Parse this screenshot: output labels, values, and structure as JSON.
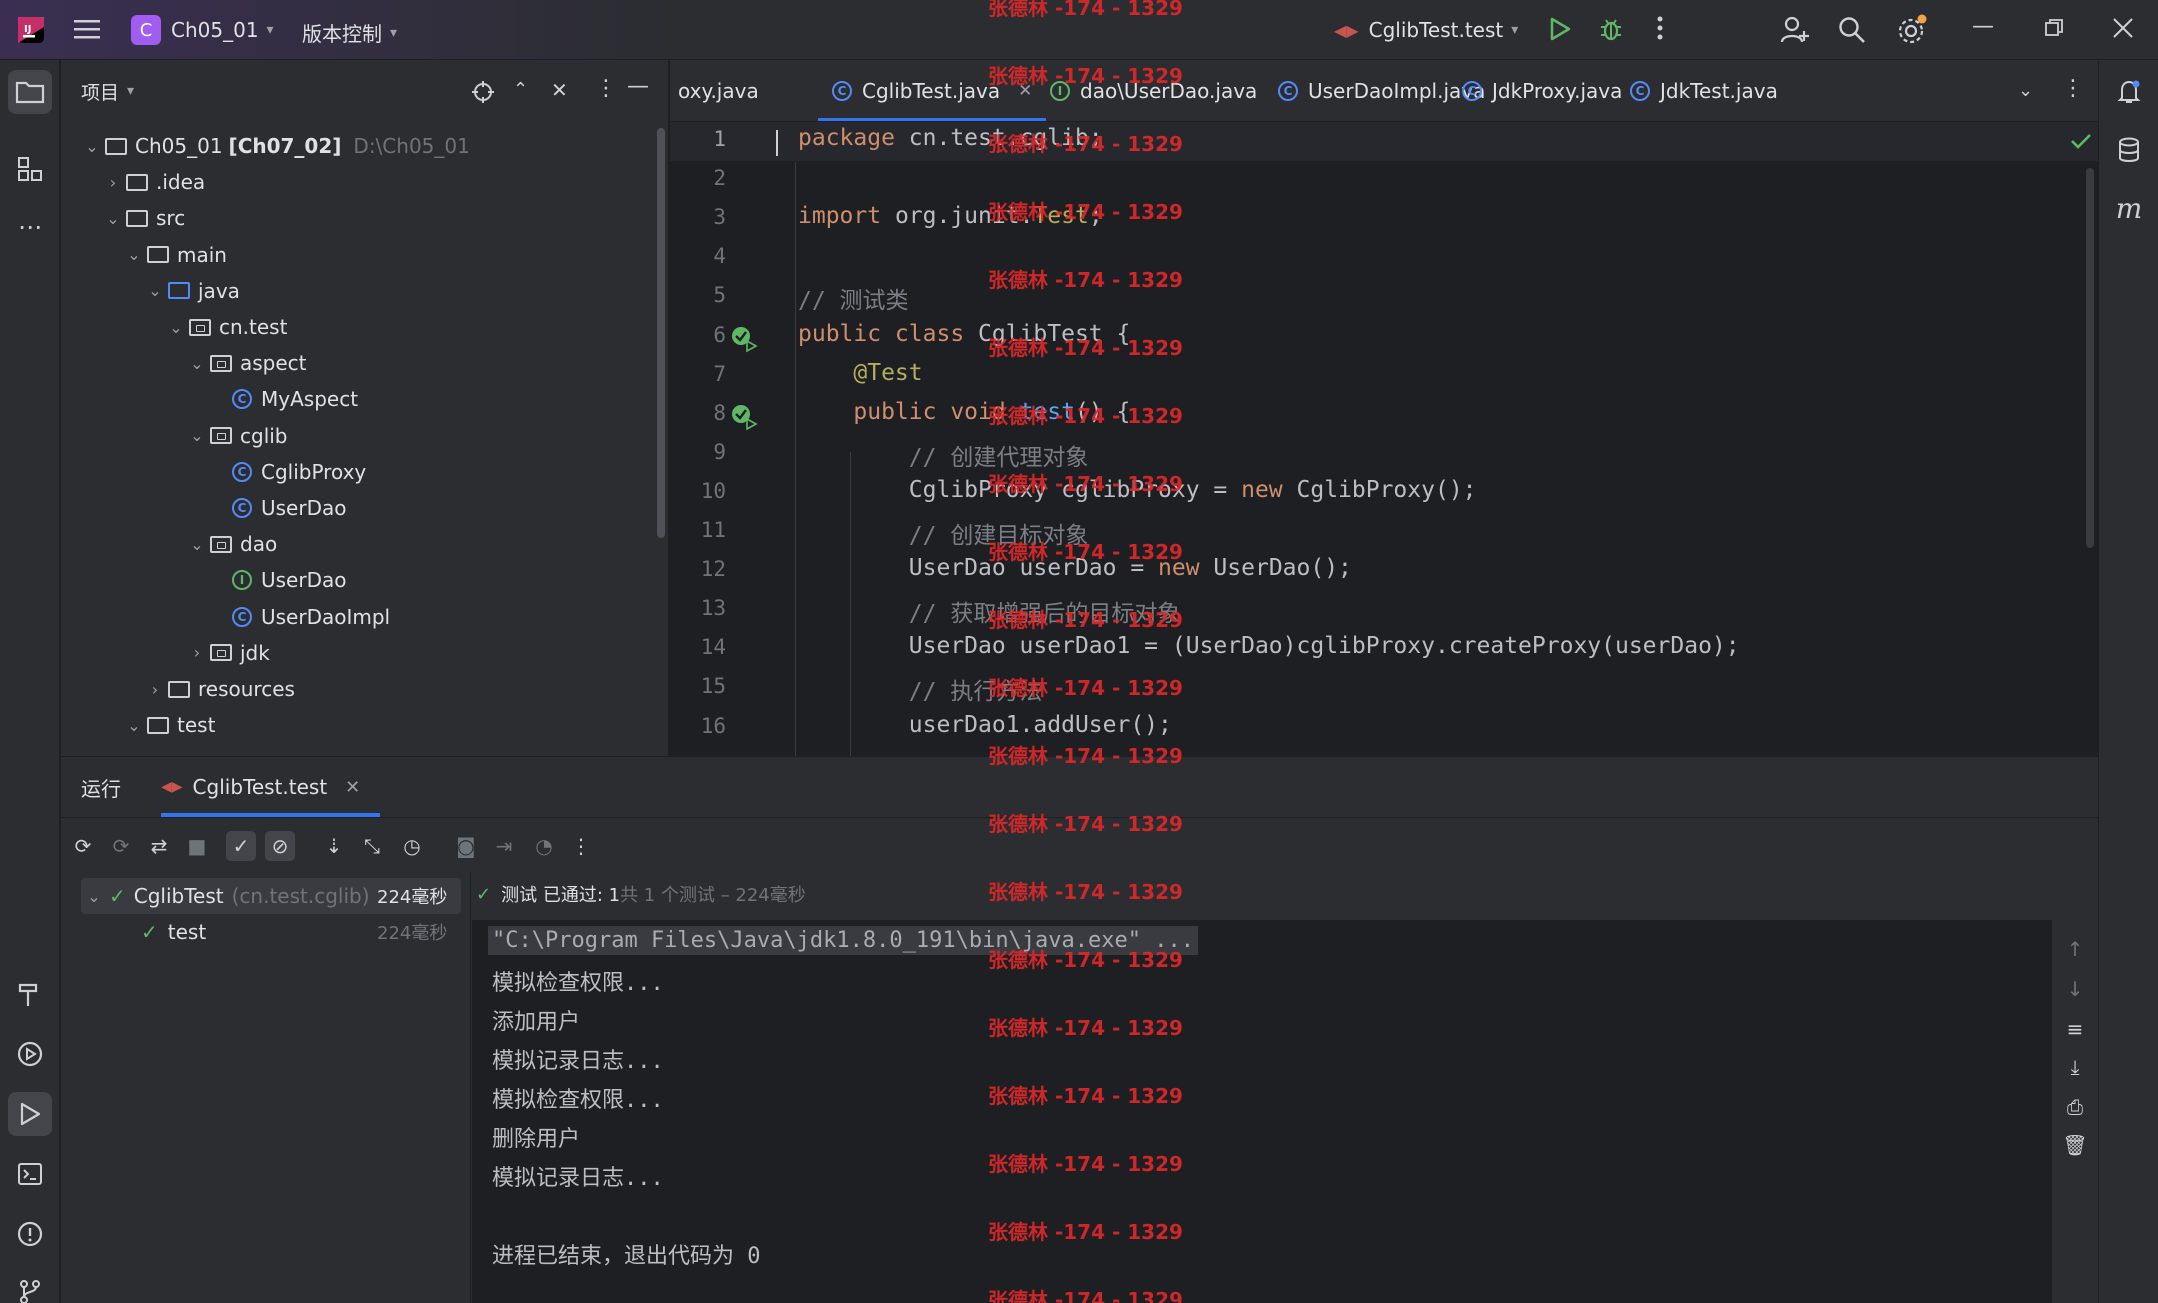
{
  "titlebar": {
    "project_initial": "C",
    "project_name": "Ch05_01",
    "vcs_label": "版本控制",
    "run_config": "CglibTest.test"
  },
  "project_panel": {
    "title": "项目",
    "tree": [
      {
        "label": "Ch05_01",
        "bold_suffix": "[Ch07_02]",
        "path": "D:\\Ch05_01",
        "level": 0,
        "type": "module",
        "expanded": true
      },
      {
        "label": ".idea",
        "level": 1,
        "type": "folder",
        "expanded": false
      },
      {
        "label": "src",
        "level": 1,
        "type": "folder",
        "expanded": true
      },
      {
        "label": "main",
        "level": 2,
        "type": "folder",
        "expanded": true
      },
      {
        "label": "java",
        "level": 3,
        "type": "folder-blue",
        "expanded": true
      },
      {
        "label": "cn.test",
        "level": 4,
        "type": "package",
        "expanded": true
      },
      {
        "label": "aspect",
        "level": 5,
        "type": "package",
        "expanded": true
      },
      {
        "label": "MyAspect",
        "level": 6,
        "type": "class"
      },
      {
        "label": "cglib",
        "level": 5,
        "type": "package",
        "expanded": true
      },
      {
        "label": "CglibProxy",
        "level": 6,
        "type": "class"
      },
      {
        "label": "UserDao",
        "level": 6,
        "type": "class"
      },
      {
        "label": "dao",
        "level": 5,
        "type": "package",
        "expanded": true
      },
      {
        "label": "UserDao",
        "level": 6,
        "type": "interface"
      },
      {
        "label": "UserDaoImpl",
        "level": 6,
        "type": "class"
      },
      {
        "label": "jdk",
        "level": 5,
        "type": "package",
        "expanded": false
      },
      {
        "label": "resources",
        "level": 3,
        "type": "folder",
        "expanded": false
      },
      {
        "label": "test",
        "level": 2,
        "type": "folder",
        "expanded": true
      }
    ]
  },
  "editor_tabs": [
    {
      "label": "oxy.java",
      "icon": "none",
      "active": false
    },
    {
      "label": "CglibTest.java",
      "icon": "class",
      "active": true,
      "closable": true
    },
    {
      "label": "dao\\UserDao.java",
      "icon": "interface",
      "active": false
    },
    {
      "label": "UserDaoImpl.java",
      "icon": "class",
      "active": false
    },
    {
      "label": "JdkProxy.java",
      "icon": "class",
      "active": false
    },
    {
      "label": "JdkTest.java",
      "icon": "class",
      "active": false
    }
  ],
  "code": {
    "line_numbers": [
      "1",
      "2",
      "3",
      "4",
      "5",
      "6",
      "7",
      "8",
      "9",
      "10",
      "11",
      "12",
      "13",
      "14",
      "15",
      "16"
    ],
    "lines": [
      [
        [
          "kw",
          "package"
        ],
        [
          "plain",
          " cn.test.cglib;"
        ]
      ],
      [],
      [
        [
          "kw",
          "import"
        ],
        [
          "plain",
          " org.junit."
        ],
        [
          "ann",
          "Test"
        ],
        [
          "plain",
          ";"
        ]
      ],
      [],
      [
        [
          "cmt",
          "// 测试类"
        ]
      ],
      [
        [
          "kw",
          "public class"
        ],
        [
          "plain",
          " CglibTest {"
        ]
      ],
      [
        [
          "plain",
          "    "
        ],
        [
          "ann",
          "@Test"
        ]
      ],
      [
        [
          "plain",
          "    "
        ],
        [
          "kw",
          "public void"
        ],
        [
          "plain",
          " "
        ],
        [
          "fn",
          "test"
        ],
        [
          "plain",
          "() {"
        ]
      ],
      [
        [
          "plain",
          "        "
        ],
        [
          "cmt",
          "// 创建代理对象"
        ]
      ],
      [
        [
          "plain",
          "        CglibProxy cglibProxy = "
        ],
        [
          "kw",
          "new"
        ],
        [
          "plain",
          " CglibProxy();"
        ]
      ],
      [
        [
          "plain",
          "        "
        ],
        [
          "cmt",
          "// 创建目标对象"
        ]
      ],
      [
        [
          "plain",
          "        UserDao userDao = "
        ],
        [
          "kw",
          "new"
        ],
        [
          "plain",
          " UserDao();"
        ]
      ],
      [
        [
          "plain",
          "        "
        ],
        [
          "cmt",
          "// 获取增强后的目标对象"
        ]
      ],
      [
        [
          "plain",
          "        UserDao userDao1 = (UserDao)cglibProxy.createProxy(userDao);"
        ]
      ],
      [
        [
          "plain",
          "        "
        ],
        [
          "cmt",
          "// 执行方法"
        ]
      ],
      [
        [
          "plain",
          "        userDao1.addUser();"
        ]
      ]
    ]
  },
  "watermark": "张德林 -174 - 1329",
  "run_panel": {
    "title": "运行",
    "tab_label": "CglibTest.test",
    "tests": [
      {
        "name": "CglibTest",
        "pkg": "(cn.test.cglib)",
        "time": "224毫秒"
      },
      {
        "name": "test",
        "time": "224毫秒"
      }
    ],
    "status_prefix": "测试 已通过: 1",
    "status_suffix": "共 1 个测试 – 224毫秒",
    "console": [
      "\"C:\\Program Files\\Java\\jdk1.8.0_191\\bin\\java.exe\" ...",
      "模拟检查权限...",
      "添加用户",
      "模拟记录日志...",
      "模拟检查权限...",
      "删除用户",
      "模拟记录日志...",
      "",
      "进程已结束，退出代码为 0"
    ]
  },
  "colors": {
    "accent": "#3574f0",
    "keyword": "#cf8e6d",
    "annotation": "#b3ae60",
    "comment": "#7a7e85",
    "function": "#56a8f5",
    "success": "#5fb865",
    "watermark": "#e0282a"
  }
}
